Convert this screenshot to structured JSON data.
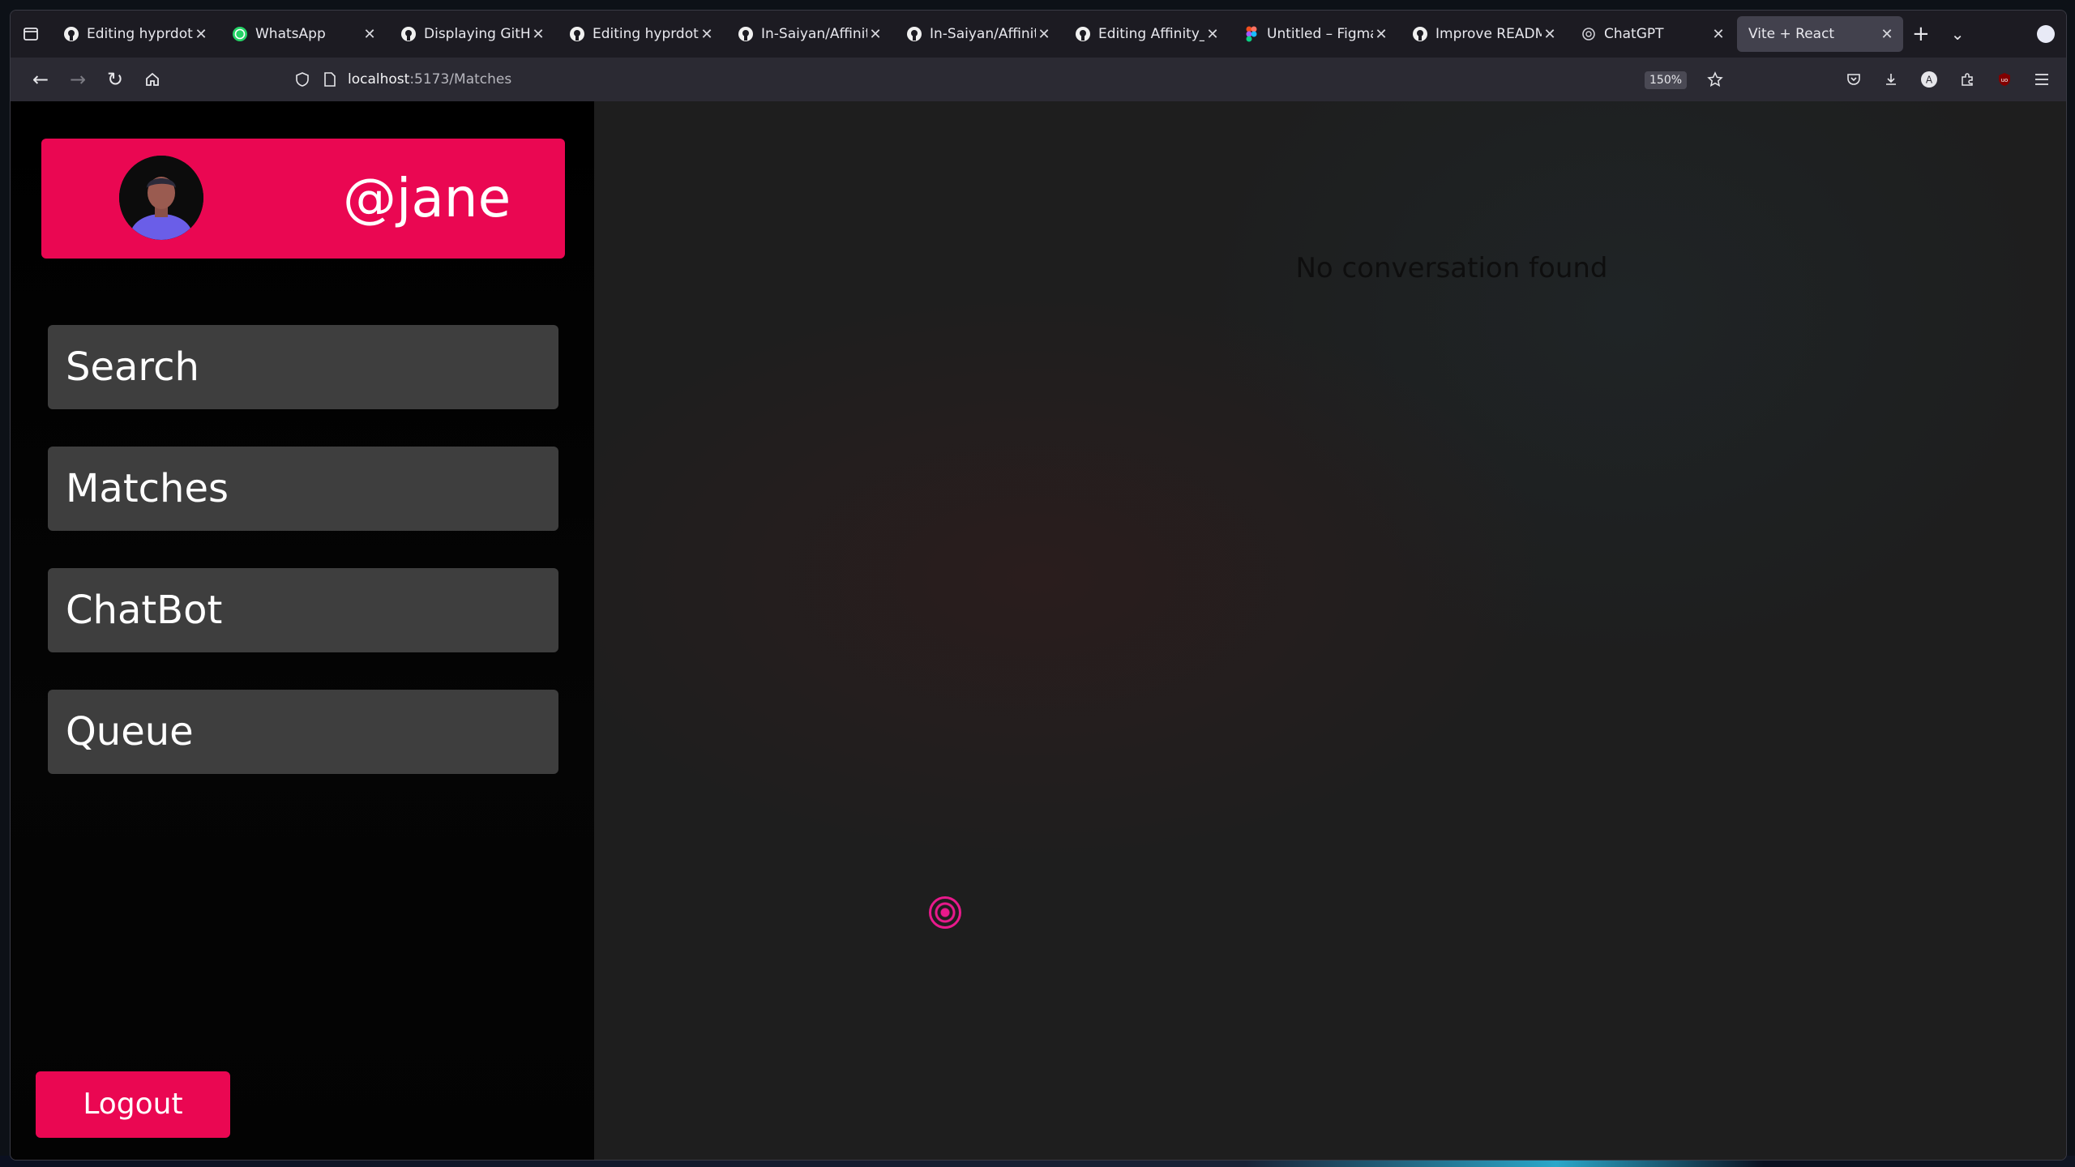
{
  "browser": {
    "tabs": [
      {
        "title": "Editing hyprdots/R",
        "icon": "github-icon",
        "active": false
      },
      {
        "title": "WhatsApp",
        "icon": "whatsapp-icon",
        "active": false
      },
      {
        "title": "Displaying GitHub",
        "icon": "github-icon",
        "active": false
      },
      {
        "title": "Editing hyprdots/R",
        "icon": "github-icon",
        "active": false
      },
      {
        "title": "In-Saiyan/Affinity_",
        "icon": "github-icon",
        "active": false
      },
      {
        "title": "In-Saiyan/Affinity_",
        "icon": "github-icon",
        "active": false
      },
      {
        "title": "Editing Affinity_fro",
        "icon": "github-icon",
        "active": false
      },
      {
        "title": "Untitled – Figma",
        "icon": "figma-icon",
        "active": false
      },
      {
        "title": "Improve README.",
        "icon": "github-icon",
        "active": false
      },
      {
        "title": "ChatGPT",
        "icon": "chatgpt-icon",
        "active": false
      },
      {
        "title": "Vite + React",
        "icon": "",
        "active": true
      }
    ],
    "url_host": "localhost",
    "url_path": ":5173/Matches",
    "zoom": "150%"
  },
  "app": {
    "username": "@jane",
    "menu": [
      {
        "label": "Search"
      },
      {
        "label": "Matches"
      },
      {
        "label": "ChatBot"
      },
      {
        "label": "Queue"
      }
    ],
    "logout_label": "Logout",
    "empty_message": "No conversation found"
  },
  "colors": {
    "accent": "#ea0752",
    "menu_bg": "#3e3e3e",
    "sidebar_bg": "#000000",
    "main_bg": "#1e1e1e"
  }
}
